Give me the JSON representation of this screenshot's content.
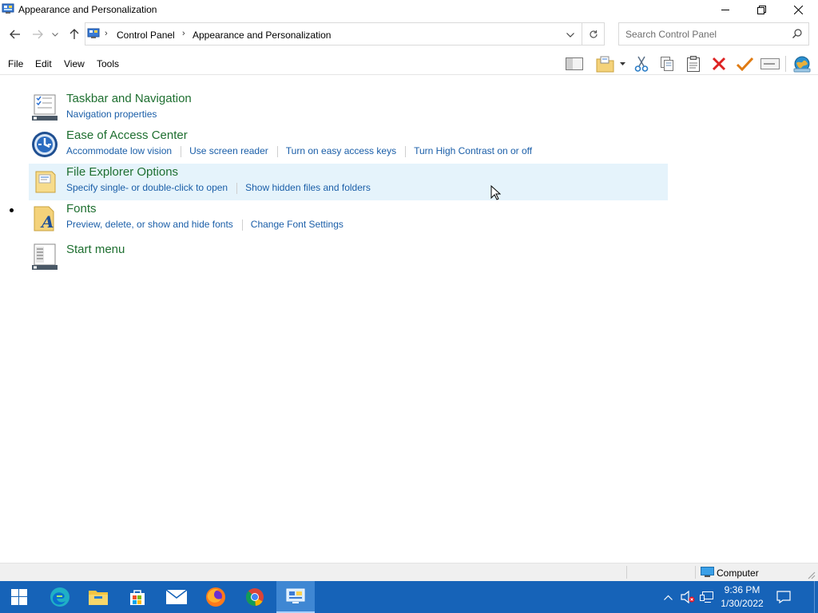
{
  "window": {
    "title": "Appearance and Personalization",
    "controls": {
      "minimize_icon": "minimize-icon",
      "restore_icon": "restore-icon",
      "close_icon": "close-icon"
    }
  },
  "address": {
    "breadcrumbs": [
      "Control Panel",
      "Appearance and Personalization"
    ],
    "separator": "›"
  },
  "search": {
    "placeholder": "Search Control Panel"
  },
  "menu": [
    "File",
    "Edit",
    "View",
    "Tools"
  ],
  "categories": [
    {
      "title": "Taskbar and Navigation",
      "icon": "taskbar-icon",
      "links": [
        "Navigation properties"
      ]
    },
    {
      "title": "Ease of Access Center",
      "icon": "ease-of-access-icon",
      "links": [
        "Accommodate low vision",
        "Use screen reader",
        "Turn on easy access keys",
        "Turn High Contrast on or off"
      ]
    },
    {
      "title": "File Explorer Options",
      "icon": "folder-options-icon",
      "links": [
        "Specify single- or double-click to open",
        "Show hidden files and folders"
      ],
      "hovered": true
    },
    {
      "title": "Fonts",
      "icon": "fonts-icon",
      "links": [
        "Preview, delete, or show and hide fonts",
        "Change Font Settings"
      ]
    },
    {
      "title": "Start menu",
      "icon": "start-menu-icon",
      "links": []
    }
  ],
  "statusbar": {
    "location": "Computer"
  },
  "taskbar": {
    "apps": [
      "start-icon",
      "edge-icon",
      "file-explorer-icon",
      "store-icon",
      "mail-icon",
      "firefox-icon",
      "chrome-icon",
      "control-panel-icon"
    ],
    "time": "9:36 PM",
    "date": "1/30/2022"
  },
  "colors": {
    "heading": "#1e6f30",
    "link": "#1a5ea8",
    "hover": "#e5f3fb",
    "taskbar": "#1663b8"
  }
}
